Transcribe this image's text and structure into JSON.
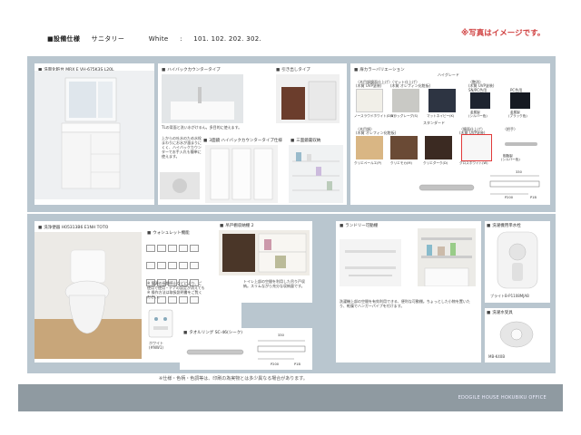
{
  "header": {
    "title": "■設備仕様",
    "brand": "サニタリー",
    "color": "White",
    "colon": ":",
    "rooms": "101. 102. 202. 302."
  },
  "image_note": "※写真はイメージです。",
  "vanity": {
    "title": "洗面化粧台 MRX E VH-675K3S L20L"
  },
  "counter": {
    "title": "ハイバックカウンタータイプ",
    "desc": "TLの背面と洗い水がけるん。多目的に使えます。",
    "desc2": "上からの吐水のため水栓まわりにお水が溜まりにくく、ハイバックカウンターでお手入れも簡単に使えます。",
    "mirror_title": "3面鏡 ハイバックカウンタータイプ仕様",
    "storage_title": "三面鏡裏収納",
    "side_title": "引き出しタイプ"
  },
  "color_variation": {
    "title": "扉カラーバリエーション",
    "high_grade": "ハイグレード",
    "standard": "スタンダード",
    "groups": [
      {
        "label": "〈木目調鏡面仕上げ〉",
        "sub": "(木質 UVP塗装)"
      },
      {
        "label": "〈マット仕上げ〉",
        "sub": "(木質 オレフィン化粧板)"
      },
      {
        "label": "〈艶消〉",
        "sub": "(木質 UVP塗装)"
      }
    ],
    "high_swatches": [
      {
        "name": "ノースラウドホワイト(DW)",
        "color": "#f1efe8"
      },
      {
        "name": "スラッグレーグ(S)",
        "color": "#c9c9c5"
      },
      {
        "name": "マットネイビー(K)",
        "color": "#2d3442"
      }
    ],
    "kinzoku": [
      {
        "name": "金属製",
        "sub": "(シルバー色)"
      },
      {
        "name": "金属製",
        "sub": "(ブラック色)"
      }
    ],
    "pc_labels": [
      "SN/PC色用",
      "PC色用"
    ],
    "std_groups": [
      {
        "label": "〈木目調〉",
        "sub": "(木質 オレフィン化粧板)"
      },
      {
        "label": "〈鏡面仕上げ〉",
        "sub": "(木質 UVP塗装)"
      },
      {
        "label": "〈把手〉",
        "sub": ""
      }
    ],
    "std_swatches": [
      {
        "name": "クリエペールエ(P)",
        "color": "#d9b684"
      },
      {
        "name": "クリエモカ(M)",
        "color": "#6a4a35"
      },
      {
        "name": "クリエダーク(D)",
        "color": "#3b2a22"
      },
      {
        "name": "グロスホワイト(W)",
        "color": "#f7f7f7"
      }
    ],
    "handle_label": "樹脂製",
    "handle_sub": "(シルバー色)",
    "dim1": "330",
    "dim2": "P200",
    "dim3": "P1B"
  },
  "toilet": {
    "title": "洗浄便器 H05313B6 E1NH  TOTO",
    "washlet_title": "ウォシュレット機能",
    "washlet_notes": "※  電源の長期停止などにより、ご使用で使用・テナの設定が消えても※  操作方法は取扱説明書をご覧ください。",
    "remote": "ホワイト",
    "remote_sub": "(#NW1)"
  },
  "upper_storage": {
    "title": "吊戸棚収納棚 2",
    "desc": "トイレ上部の空間を利用した吊り戸収納。スリムながら充分な収納量です。"
  },
  "towel_ring": {
    "title": "タオルリング SC-46(シーク)",
    "dim1": "330",
    "dim2": "P200",
    "dim3": "P1B"
  },
  "laundry": {
    "title": "ランドリー可動棚",
    "desc": "洗濯機上部の空間を有効利用できる、便利な可動棚。ちょっとした小物を置いたり、乾燥でハンガーパイプを付けます。"
  },
  "faucet": {
    "title": "洗濯機用単水栓",
    "model": "ブライトB-P1108MJAB"
  },
  "drain": {
    "title": "洗濯水受具",
    "model": "MB-K40B"
  },
  "disclaimer": "※仕様・色柄・色調等は、印刷の為実物とは多少異なる場合があります。",
  "footer": "EDOGILE HOUSE HOKUBIKU OFFICE"
}
